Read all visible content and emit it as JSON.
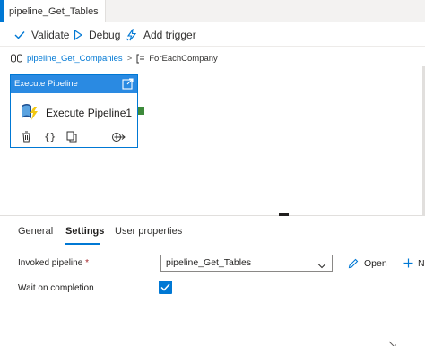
{
  "window": {
    "tab_title": "pipeline_Get_Tables"
  },
  "toolbar": {
    "validate_label": "Validate",
    "debug_label": "Debug",
    "add_trigger_label": "Add trigger"
  },
  "breadcrumb": {
    "pipeline": "pipeline_Get_Companies",
    "separator": ">",
    "current": "ForEachCompany"
  },
  "activity": {
    "type_label": "Execute Pipeline",
    "name": "Execute Pipeline1"
  },
  "panel": {
    "tabs": [
      {
        "label": "General",
        "active": false
      },
      {
        "label": "Settings",
        "active": true
      },
      {
        "label": "User properties",
        "active": false
      }
    ],
    "invoked_pipeline_label": "Invoked pipeline",
    "required_marker": "*",
    "invoked_pipeline_value": "pipeline_Get_Tables",
    "open_label": "Open",
    "new_label": "N",
    "wait_label": "Wait on completion",
    "wait_checked": true
  },
  "colors": {
    "accent": "#0078d4",
    "activity_header": "#2a8ae2",
    "connector_success": "#3d8a3b",
    "required": "#a4262c"
  },
  "icons": [
    "validate-check-icon",
    "debug-play-icon",
    "add-trigger-icon",
    "pipeline-icon",
    "foreach-icon",
    "open-external-icon",
    "execute-pipeline-icon",
    "delete-icon",
    "code-icon",
    "copy-icon",
    "add-output-icon",
    "chevron-down-icon",
    "edit-pencil-icon",
    "plus-icon",
    "checkmark-icon"
  ]
}
